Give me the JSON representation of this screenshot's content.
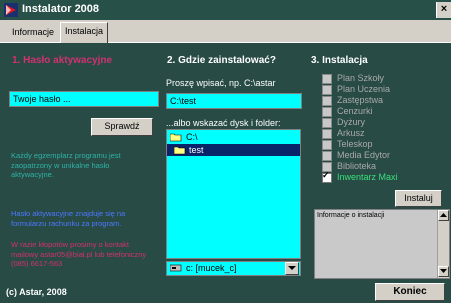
{
  "window": {
    "title": "Instalator 2008",
    "close_glyph": "×"
  },
  "tabs": [
    {
      "label": "Informacje"
    },
    {
      "label": "Instalacja"
    }
  ],
  "section1": {
    "heading": "1. Hasło aktywacyjne",
    "password_placeholder": "Twoje hasło ...",
    "check_button": "Sprawdź",
    "info1": "Każdy egzemplarz programu jest zaopatrzony w unikalne hasło aktywacyjne.",
    "info2": "Hasło aktywacyjne znajduje się na formularzu rachunku za program.",
    "info3": "W razie kłopotów prosimy o kontakt mailowy astar05@biał.pl lub telefoniczny (085) 6617-563"
  },
  "section2": {
    "heading": "2. Gdzie zainstalować?",
    "path_prompt": "Proszę wpisać, np. C:\\astar",
    "path_value": "C:\\test",
    "choose_label": "...albo wskazać dysk i folder:",
    "folders": [
      {
        "label": "C:\\",
        "selected": false
      },
      {
        "label": "test",
        "selected": true
      }
    ],
    "drive_value": "c: [mucek_c]"
  },
  "section3": {
    "heading": "3. Instalacja",
    "options": [
      {
        "label": "Plan Szkoły",
        "checked": false,
        "enabled": false
      },
      {
        "label": "Plan Uczenia",
        "checked": false,
        "enabled": false
      },
      {
        "label": "Zastępstwa",
        "checked": false,
        "enabled": false
      },
      {
        "label": "Cenzurki",
        "checked": false,
        "enabled": false
      },
      {
        "label": "Dyżury",
        "checked": false,
        "enabled": false
      },
      {
        "label": "Arkusz",
        "checked": false,
        "enabled": false
      },
      {
        "label": "Teleskop",
        "checked": false,
        "enabled": false
      },
      {
        "label": "Media Edytor",
        "checked": false,
        "enabled": false
      },
      {
        "label": "Biblioteka",
        "checked": false,
        "enabled": false
      },
      {
        "label": "Inwentarz Maxi",
        "checked": true,
        "enabled": true
      }
    ],
    "install_button": "Instaluj",
    "info_title": "Informacje o instalacji"
  },
  "status": {
    "text": "(c) Astar, 2008",
    "exit_button": "Koniec"
  },
  "colors": {
    "background": "#284b46",
    "cyan": "#00ffff",
    "heading_pink": "#d1326f",
    "selected": "#0a246a"
  }
}
